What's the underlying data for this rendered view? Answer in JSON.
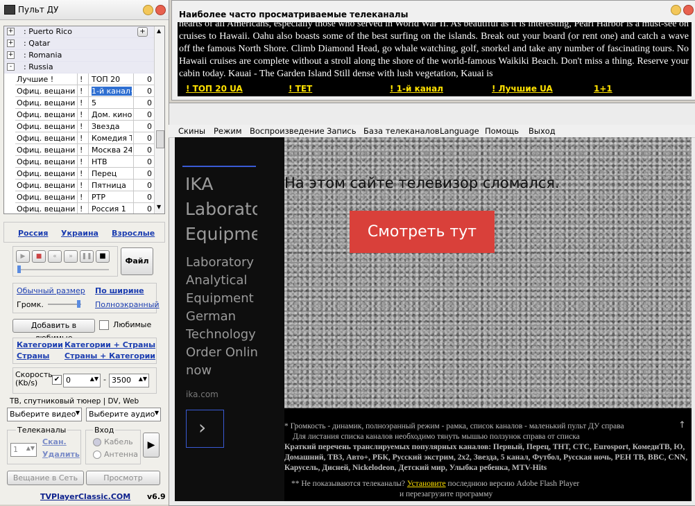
{
  "remote": {
    "title": "Пульт ДУ",
    "countries": [
      {
        "label": ": Puerto Rico",
        "sign": "+"
      },
      {
        "label": ": Qatar",
        "sign": "+"
      },
      {
        "label": ": Romania",
        "sign": "+"
      },
      {
        "label": ": Russia",
        "sign": "-"
      }
    ],
    "channels": [
      {
        "type": "Лучшие !",
        "bang": "!",
        "name": "ТОП 20",
        "count": "0"
      },
      {
        "type": "Офиц. вещание",
        "bang": "!",
        "name": "1-й канал+",
        "count": "0"
      },
      {
        "type": "Офиц. вещание",
        "bang": "!",
        "name": "5",
        "count": "0"
      },
      {
        "type": "Офиц. вещание",
        "bang": "!",
        "name": "Дом. кино",
        "count": "0"
      },
      {
        "type": "Офиц. вещание",
        "bang": "!",
        "name": "Звезда",
        "count": "0"
      },
      {
        "type": "Офиц. вещание",
        "bang": "!",
        "name": "Комедия Т",
        "count": "0"
      },
      {
        "type": "Офиц. вещание",
        "bang": "!",
        "name": "Москва 24",
        "count": "0"
      },
      {
        "type": "Офиц. вещание",
        "bang": "!",
        "name": "НТВ",
        "count": "0"
      },
      {
        "type": "Офиц. вещание",
        "bang": "!",
        "name": "Перец",
        "count": "0"
      },
      {
        "type": "Офиц. вещание",
        "bang": "!",
        "name": "Пятница",
        "count": "0"
      },
      {
        "type": "Офиц. вещание",
        "bang": "!",
        "name": "РТР",
        "count": "0"
      },
      {
        "type": "Офиц. вещание",
        "bang": "!",
        "name": "Россия 1",
        "count": "0"
      }
    ],
    "quick_links": [
      "Россия",
      "Украина",
      "Взрослые"
    ],
    "file_button": "Файл",
    "size_normal": "Обычный размер",
    "size_width": "По ширине",
    "volume_label": "Громк.",
    "fullscreen": "Полноэкранный",
    "add_favorites": "Добавить в любимые",
    "favorites": "Любимые",
    "cat_links": [
      "Категории",
      "Категории + Страны",
      "Страны",
      "Страны + Категории"
    ],
    "speed_label": "Скорость (Kb/s)",
    "speed_from": "0",
    "speed_dash": "-",
    "speed_to": "3500",
    "tuner_label": "ТВ, спутниковый тюнер | DV, Web камера",
    "select_video": "Выберите видео",
    "select_audio": "Выберите аудио",
    "tv_channels_label": "Телеканалы",
    "tv_channel_num": "1",
    "scan": "Скан.",
    "delete": "Удалить",
    "input_label": "Вход",
    "cable": "Кабель",
    "antenna": "Антенна",
    "broadcast_button": "Вещание в Сеть",
    "preview_button": "Просмотр",
    "footer_link": "TVPlayerClassic.COM",
    "version": "v6.9"
  },
  "ticker": {
    "title": "Наиболее часто просматриваемые телеканалы",
    "text": "hearts of all Americans, especially those who served in World War II. As beautiful as it is interesting, Pearl Harbor is a must-see on cruises to Hawaii. Oahu also boasts some of the best surfing on the islands. Break out your board (or rent one) and catch a wave off the famous North Shore. Climb Diamond Head, go whale watching, golf, snorkel and take any number of fascinating tours. No Hawaii cruises are complete without a stroll along the shore of the world-famous Waikiki Beach. Don't miss a thing. Reserve your cabin today. Kauai - The Garden Island Still dense with lush vegetation, Kauai is",
    "links": [
      "!      ТОП 20 UA",
      "!    TET",
      "!      1-й канал",
      "!      Лучшие UA",
      "1+1"
    ]
  },
  "menu": [
    "Скины",
    "Режим",
    "Воспроизведение",
    "Запись",
    "База телеканалов",
    "Language",
    "Помощь",
    "Выход"
  ],
  "ad": {
    "brand_lines": [
      "IKA",
      "Laborato",
      "Equipme"
    ],
    "body_lines": [
      "Laboratory",
      "Analytical",
      "Equipment",
      "German",
      "Technology",
      "Order Onlin",
      "now"
    ],
    "domain": "ika.com",
    "broken_text": "На этом сайте телевизор сломался.",
    "watch_button": "Смотреть тут"
  },
  "info": {
    "line1": "* Громкость - динамик, полноэранный режим - рамка, список каналов - маленький пульт ДУ справа",
    "line2": "Для листания списка каналов необходимо тянуть мышью ползунок справа от списка",
    "line3": "Краткий перечень транслируемых популярных каналов: Первый, Перец, ТНТ, СТС, Eurosport, КомедиТВ, Ю, Домашний, ТВ3, Авто+, РБК, Русский экстрим, 2х2, Звезда, 5 канал, Футбол, Русская ночь, РЕН ТВ, BBC, CNN, Карусель, Дисней, Nickelodeon, Детский мир, Улыбка ребенка, MTV-Hits",
    "line4_pre": "** Не показываются телеканалы?",
    "line4_link": "Установите",
    "line4_post": "последнюю версию Adobe Flash Player",
    "line5": "и перезагрузите программу"
  },
  "colors": {
    "accent_link": "#1a3cb0",
    "ticker_link": "#ffe100",
    "watch_button": "#d9403a",
    "selected_cell": "#2f6fd1"
  }
}
